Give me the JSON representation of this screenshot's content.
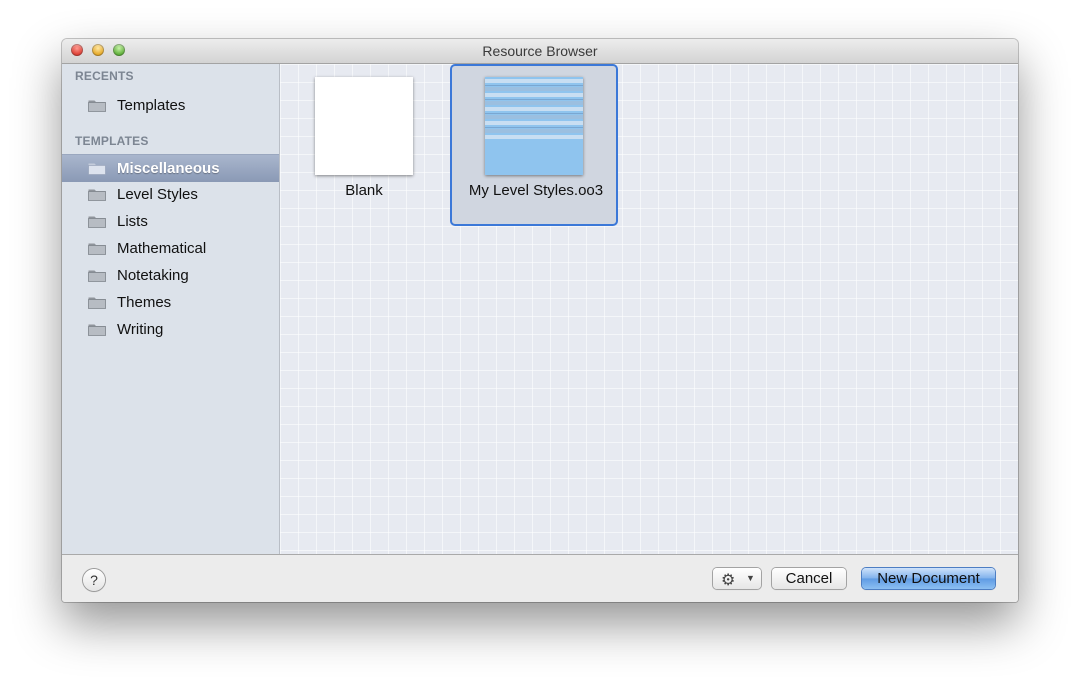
{
  "window": {
    "title": "Resource Browser"
  },
  "sidebar": {
    "recents_header": "RECENTS",
    "recents": [
      {
        "label": "Templates",
        "icon": "folder-icon"
      }
    ],
    "templates_header": "TEMPLATES",
    "templates": [
      {
        "label": "Miscellaneous",
        "icon": "folder-icon",
        "selected": true
      },
      {
        "label": "Level Styles",
        "icon": "folder-icon"
      },
      {
        "label": "Lists",
        "icon": "folder-icon"
      },
      {
        "label": "Mathematical",
        "icon": "folder-icon"
      },
      {
        "label": "Notetaking",
        "icon": "folder-icon"
      },
      {
        "label": "Themes",
        "icon": "folder-icon"
      },
      {
        "label": "Writing",
        "icon": "folder-icon"
      }
    ]
  },
  "content": {
    "items": [
      {
        "name": "Blank",
        "selected": false
      },
      {
        "name": "My Level Styles.oo3",
        "selected": true
      }
    ]
  },
  "footer": {
    "help_label": "?",
    "gear_icon": "⚙",
    "gear_chevron": "▼",
    "cancel_label": "Cancel",
    "new_document_label": "New Document"
  },
  "colors": {
    "selection_border": "#3b78d8",
    "sidebar_background": "#dce2ea",
    "sidebar_selected": "#8a99b5",
    "primary_button": "#5f9be4"
  }
}
